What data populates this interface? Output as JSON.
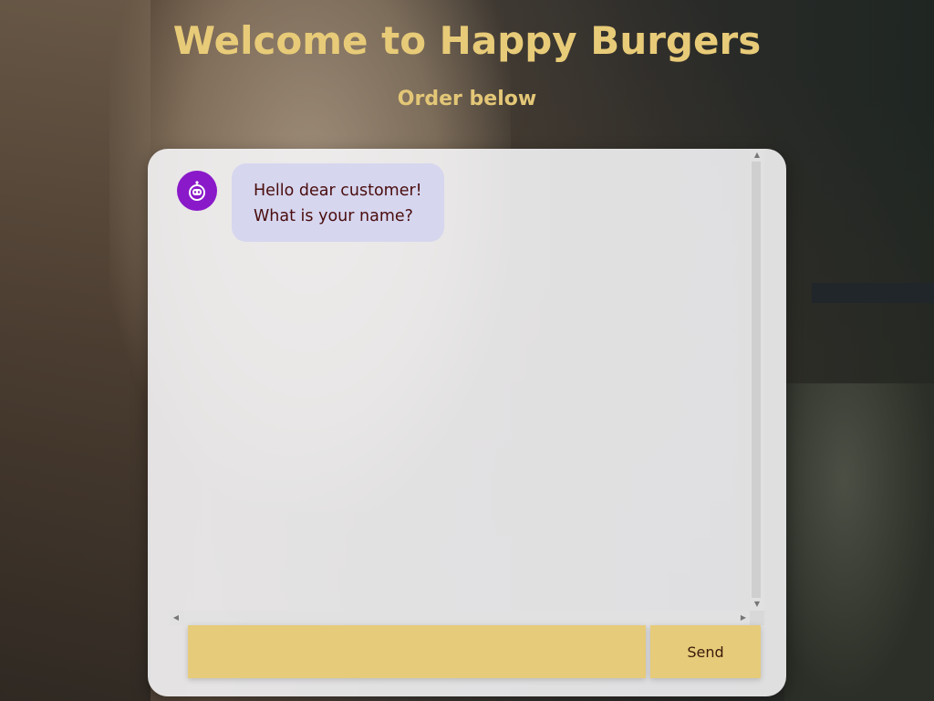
{
  "header": {
    "title": "Welcome to Happy Burgers",
    "subtitle": "Order below"
  },
  "chat": {
    "messages": [
      {
        "sender": "bot",
        "avatar_icon": "robot-icon",
        "lines": [
          "Hello dear customer!",
          "What is your name?"
        ]
      }
    ],
    "input": {
      "value": "",
      "placeholder": ""
    },
    "send_label": "Send"
  },
  "colors": {
    "title": "#e8cb78",
    "accent": "#e6cb7a",
    "bot_avatar": "#8a19c9",
    "bubble_text": "#4a0d0d"
  }
}
